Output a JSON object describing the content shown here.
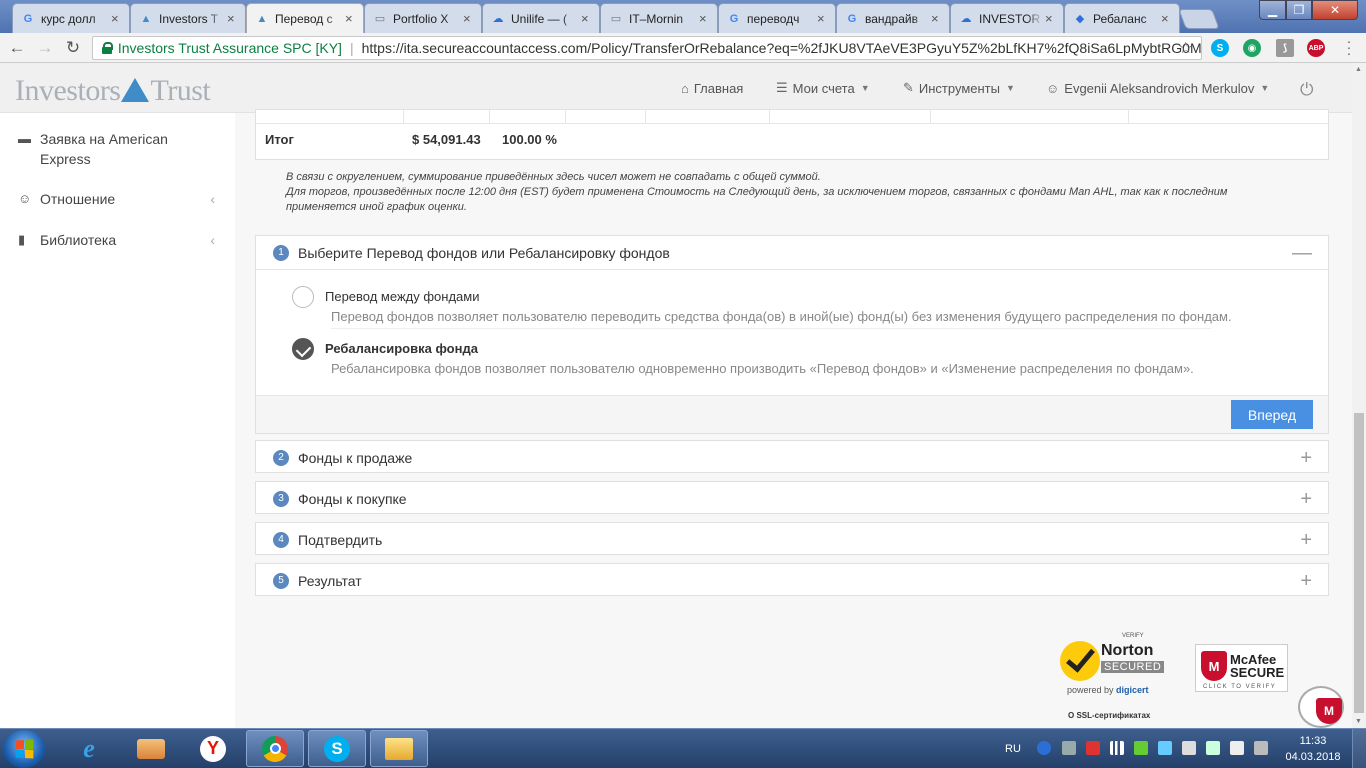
{
  "browser": {
    "tabs": [
      {
        "title": "курс долл",
        "icon": "G",
        "icon_color": "#4285f4"
      },
      {
        "title": "Investors T",
        "icon": "▲",
        "icon_color": "#3f8cc9"
      },
      {
        "title": "Перевод с",
        "icon": "▲",
        "icon_color": "#3f8cc9"
      },
      {
        "title": "Portfolio X",
        "icon": "▭",
        "icon_color": "#777777"
      },
      {
        "title": "Unilife — (",
        "icon": "☁",
        "icon_color": "#2e6fd8"
      },
      {
        "title": "IT–Mornin",
        "icon": "▭",
        "icon_color": "#777777"
      },
      {
        "title": "переводч",
        "icon": "G",
        "icon_color": "#4285f4"
      },
      {
        "title": "вандрайв",
        "icon": "G",
        "icon_color": "#4285f4"
      },
      {
        "title": "INVESTOR",
        "icon": "☁",
        "icon_color": "#2e6fd8"
      },
      {
        "title": "Ребаланс",
        "icon": "◆",
        "icon_color": "#2e6fd8"
      }
    ],
    "close_glyph": "×",
    "site_identity": "Investors Trust Assurance SPC [KY]",
    "url_separator": "|",
    "url": "https://ita.secureaccountaccess.com/Policy/TransferOrRebalance?eq=%2fJKU8VTAeVE3PGyuY5Z%2bLfKH7%2fQ8iSa6LpMybtRG0M...",
    "extensions": [
      {
        "name": "skype-extension-icon",
        "label": "S",
        "color": "#00aff0"
      },
      {
        "name": "eye-extension-icon",
        "label": "◉",
        "color": "#1fa463"
      },
      {
        "name": "pdf-extension-icon",
        "label": "⟆",
        "color": "#999999"
      },
      {
        "name": "adblock-extension-icon",
        "label": "ABP",
        "color": "#c8102e"
      }
    ]
  },
  "site": {
    "logo_left": "Investors",
    "logo_right": "Trust",
    "nav": {
      "home": "Главная",
      "accounts": "Мои счета",
      "tools": "Инструменты",
      "user": "Evgenii Aleksandrovich Merkulov"
    },
    "sidebar": [
      {
        "label": "Заявка на American Express",
        "icon": "▬"
      },
      {
        "label": "Отношение",
        "icon": "☺"
      },
      {
        "label": "Библиотека",
        "icon": "▮"
      }
    ],
    "sidebar_arrow": "‹",
    "totals": {
      "label": "Итог",
      "amount": "$ 54,091.43",
      "percent": "100.00 %"
    },
    "notes": [
      "В связи с округлением, суммирование приведённых здесь чисел может не совпадать с общей суммой.",
      "Для торгов, произведённых после 12:00 дня (EST) будет применена Стоимость на Следующий день, за исключением торгов, связанных с фондами Man AHL, так как к последним применяется иной график оценки."
    ],
    "steps": [
      {
        "number": "1",
        "title": "Выберите Перевод фондов или Ребалансировку фондов",
        "toggle": "—"
      },
      {
        "number": "2",
        "title": "Фонды к продаже",
        "toggle": "+"
      },
      {
        "number": "3",
        "title": "Фонды к покупке",
        "toggle": "+"
      },
      {
        "number": "4",
        "title": "Подтвердить",
        "toggle": "+"
      },
      {
        "number": "5",
        "title": "Результат",
        "toggle": "+"
      }
    ],
    "options": [
      {
        "title": "Перевод между фондами",
        "desc": "Перевод фондов позволяет пользователю переводить средства фонда(ов) в иной(ые) фонд(ы) без изменения будущего распределения по фондам.",
        "selected": false
      },
      {
        "title": "Ребалансировка фонда",
        "desc": "Ребалансировка фондов позволяет пользователю одновременно производить «Перевод фондов» и «Изменение распределения по фондам».",
        "selected": true
      }
    ],
    "next_button": "Вперед",
    "badges": {
      "norton_verify": "VERIFY",
      "norton_name": "Norton",
      "norton_secured": "SECURED",
      "norton_powered": "powered by",
      "norton_digicert": "digicert",
      "mcafee_l1": "McAfee",
      "mcafee_l2": "SECURE",
      "mcafee_click": "CLICK TO VERIFY",
      "mcafee_shield": "M",
      "ssl": "О SSL-сертификатах"
    }
  },
  "taskbar": {
    "lang": "RU",
    "time": "11:33",
    "date": "04.03.2018"
  },
  "colors": {
    "accent": "#4a90e2",
    "step_number": "#5b88bf",
    "secure_green": "#0b8043"
  }
}
